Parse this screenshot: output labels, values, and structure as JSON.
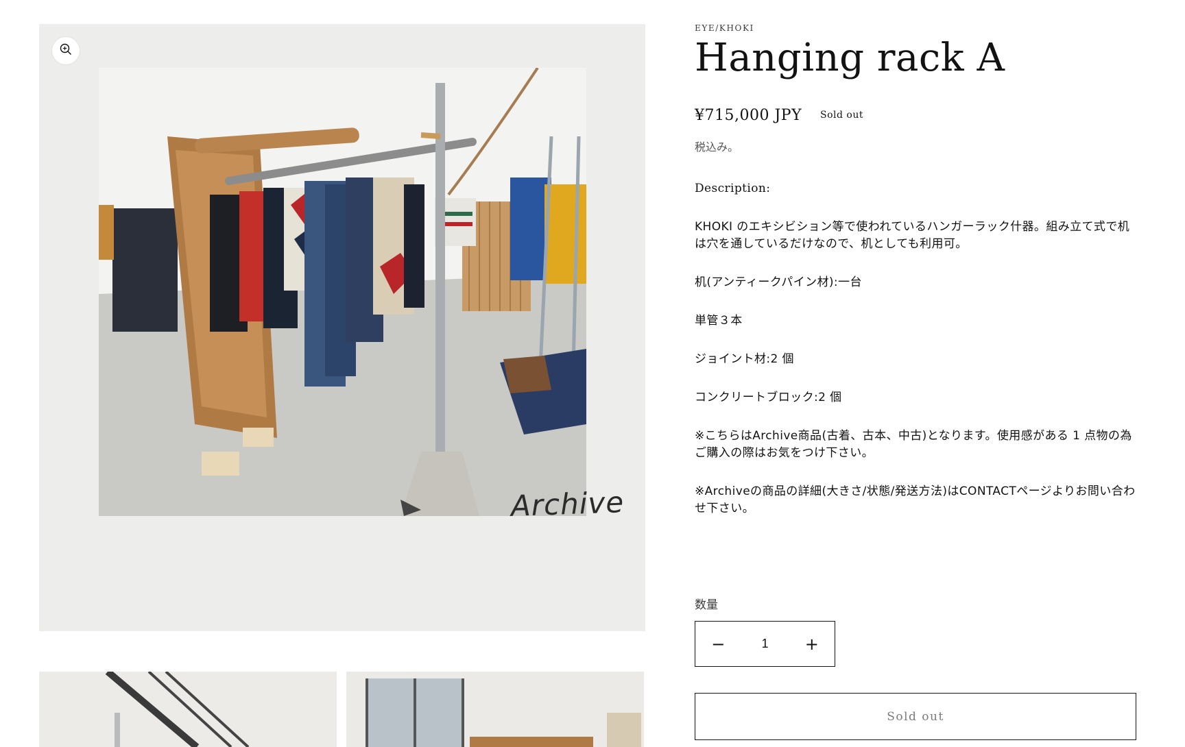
{
  "gallery": {
    "main_image_alt": "Hanging rack A",
    "watermark": "Archive",
    "zoom_icon": "zoom-in-icon"
  },
  "product": {
    "vendor": "EYE/KHOKI",
    "title": "Hanging rack A",
    "price": "¥715,000 JPY",
    "badge": "Sold out",
    "tax_note": "税込み。",
    "description": [
      "Description:",
      "KHOKI のエキシビション等で使われているハンガーラック什器。組み立て式で机は穴を通しているだけなので、机としても利用可。",
      "机(アンティークパイン材):一台",
      "単管３本",
      "ジョイント材:2 個",
      "コンクリートブロック:2 個",
      "※こちらはArchive商品(古着、古本、中古)となります。使用感がある 1 点物の為ご購入の際はお気をつけ下さい。",
      "※Archiveの商品の詳細(大きさ/状態/発送方法)はCONTACTページよりお問い合わせ下さい。"
    ],
    "quantity_label": "数量",
    "quantity_value": "1",
    "decrease_symbol": "−",
    "increase_symbol": "+",
    "sold_out_button": "Sold out"
  },
  "colors": {
    "text": "#121212",
    "media_background": "#ededec",
    "disabled_text": "#7a7a7a"
  }
}
